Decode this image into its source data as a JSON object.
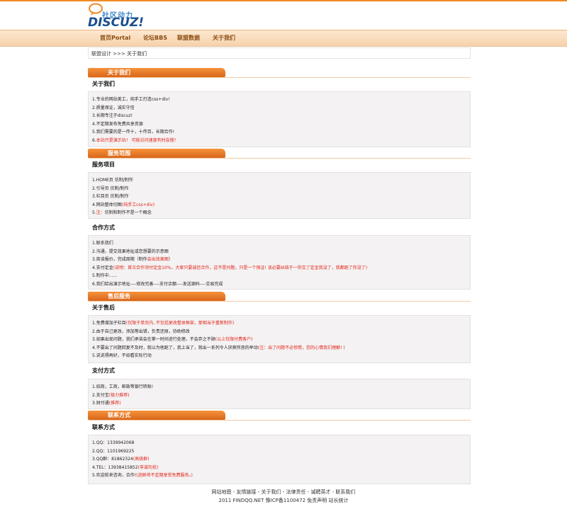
{
  "logo": {
    "cn": "社区动力",
    "en": "DISCUZ!"
  },
  "nav": [
    "首页Portal",
    "论坛BBS",
    "联盟数据",
    "关于我们"
  ],
  "breadcrumb": "联盟设计 >>> 关于我们",
  "sections": {
    "about": {
      "bar": "关于我们",
      "title": "关于我们",
      "lines": [
        {
          "n": "1.",
          "t": "专业的网站美工，纯手工打造css+div!",
          "r": ""
        },
        {
          "n": "2.",
          "t": "质量保证，诚实守信",
          "r": ""
        },
        {
          "n": "3.",
          "t": "长期专注于discuz!",
          "r": ""
        },
        {
          "n": "4.",
          "t": "不定期发布免费共享资源",
          "r": ""
        },
        {
          "n": "5.",
          "t": "我们需要的是一传十，十传百，长期合作!",
          "r": ""
        },
        {
          "n": "6.",
          "t": "",
          "r": "本站只是演示站！ 可能访问速度有时会慢！"
        }
      ]
    },
    "service": {
      "bar": "服务范围",
      "title": "服务项目",
      "lines": [
        {
          "n": "1.",
          "t": "HOME页  仿制/制作",
          "r": ""
        },
        {
          "n": "2.",
          "t": "引导页  仿制/制作",
          "r": ""
        },
        {
          "n": "3.",
          "t": "栏目页  仿制/制作",
          "r": ""
        },
        {
          "n": "4.",
          "t": "网站整体切图",
          "r": "(纯手工css+div)"
        },
        {
          "n": "5.",
          "t": "",
          "r": "注：",
          "t2": "仿制和制作不是一个概念"
        }
      ],
      "title2": "合作方式",
      "lines2": [
        {
          "n": "1.",
          "t": "联系我们",
          "r": ""
        },
        {
          "n": "2.",
          "t": "沟通，提交效果地址或您想要的示意图",
          "r": ""
        },
        {
          "n": "3.",
          "t": "商谈报价，完成周期（制作",
          "r": "会出效果图",
          "t2": "）"
        },
        {
          "n": "4.",
          "t": "支付定金",
          "r": "(说明：首次合作须付定金10%，大家只要诚信合作，这不是问题，只是一个保证! 谈必要纠结于一你交了定金我没了，我都跑了你没了)"
        },
        {
          "n": "5.",
          "t": "制作中......",
          "r": ""
        },
        {
          "n": "6.",
          "t": "我们给出演示地址----修改完善----支付余额----发送源码----交易完成",
          "r": ""
        }
      ]
    },
    "after": {
      "bar": "售后服务",
      "title": "关于售后",
      "lines": [
        {
          "n": "1.",
          "t": "免费增加子栏目",
          "r": "(仅限于单页内, 不包括更改整体框架，那相当于重新制作)"
        },
        {
          "n": "2.",
          "t": "由于自己更改，添加等出错，负责还原，协助修改",
          "r": ""
        },
        {
          "n": "3.",
          "t": "如果出现问题，我们承诺会在第一时间进行处理，不会弃之不顾",
          "r": "(以上仅限付费客户)"
        },
        {
          "n": "4.",
          "t": "不要出了问题回复不及时，就以为他跑了，我上当了，就出一系列令人厌爽所恶的举动",
          "r": "(注：出了问题不必惊慌，您的心情我们理解! )"
        },
        {
          "n": "5.",
          "t": "说说得再好，不如看实际行动",
          "r": ""
        }
      ],
      "title2": "支付方式",
      "lines2": [
        {
          "n": "1.",
          "t": "招商，工商，邮政等银行转账!",
          "r": ""
        },
        {
          "n": "2.",
          "t": "支付宝",
          "r": "(极力推荐)"
        },
        {
          "n": "3.",
          "t": "财付通",
          "r": "(推荐)"
        }
      ]
    },
    "contact": {
      "bar": "联系方式",
      "title": "联系方式",
      "lines": [
        {
          "n": "1.",
          "t": "QQ：1339942068",
          "r": ""
        },
        {
          "n": "2.",
          "t": "QQ：1101969225",
          "r": ""
        },
        {
          "n": "3.",
          "t": "QQ群：81862324",
          "r": "(高级群)"
        },
        {
          "n": "4.",
          "t": "TEL：13938415852",
          "r": "(非诚勿扰)"
        },
        {
          "n": "5.",
          "t": "欢迎前来咨询，合作!",
          "r": "(进群将不定期享受免费服务。)"
        }
      ]
    }
  },
  "footer": {
    "links": "网站地图 - 友情链接 - 关于我们 - 法律责任 - 诚聘英才 - 联系我们",
    "copy": "2011 FINDQQ.NET 豫ICP备1100472 免责声明 站长统计"
  },
  "colors": {
    "accent": "#f08a24",
    "red": "#e0241b",
    "nav_text": "#8a4b10"
  }
}
